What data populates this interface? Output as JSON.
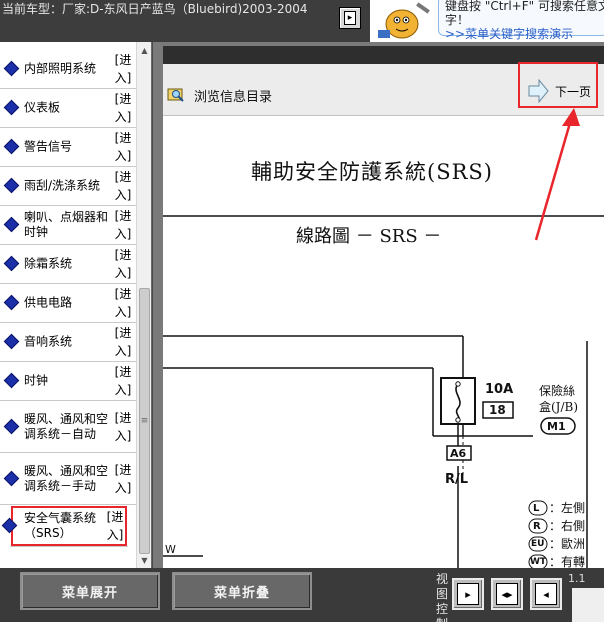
{
  "header": {
    "current_model": "当前车型：厂家:D-东风日产蓝鸟（Bluebird)2003-2004",
    "tip_line1": "键盘按 \"Ctrl+F\" 可搜索任意文",
    "tip_line2": "字！",
    "tip_link": ">>菜单关键字搜索演示"
  },
  "sidebar": {
    "enter_label": "[进入]",
    "items": [
      {
        "label": "内部照明系统"
      },
      {
        "label": "仪表板"
      },
      {
        "label": "警告信号"
      },
      {
        "label": "雨刮/洗涤系统"
      },
      {
        "label": "喇叭、点烟器和时钟"
      },
      {
        "label": "除霜系统"
      },
      {
        "label": "供电电路"
      },
      {
        "label": "音响系统"
      },
      {
        "label": "时钟"
      },
      {
        "label": "暖风、通风和空调系统－自动"
      },
      {
        "label": "暖风、通风和空调系统－手动"
      },
      {
        "label": "安全气囊系统（SRS）"
      }
    ]
  },
  "content": {
    "browse_label": "浏览信息目录",
    "next_page_label": "下一页",
    "diagram": {
      "title": "輔助安全防護系統(SRS)",
      "subtitle": "線路圖 － SRS －",
      "fuse_rating": "10A",
      "fuse_number": "18",
      "fuse_box_line1": "保險絲",
      "fuse_box_line2": "盒(J/B)",
      "fuse_box_code": "M1",
      "connector": "A6",
      "wire_color": "R/L",
      "left_marker": "W",
      "legend": [
        {
          "symbol": "L",
          "text": "：左側"
        },
        {
          "symbol": "R",
          "text": "：右側"
        },
        {
          "symbol": "EU",
          "text": "：歐洲"
        },
        {
          "symbol": "WT",
          "text": "：有轉"
        }
      ]
    }
  },
  "footer": {
    "expand_menu": "菜单展开",
    "collapse_menu": "菜单折叠",
    "view_control": "视图控制",
    "version": "1.1"
  },
  "colors": {
    "highlight_red": "#e8262b",
    "menu_diamond": "#1b2fa8",
    "tip_link": "#2a5fc9"
  }
}
